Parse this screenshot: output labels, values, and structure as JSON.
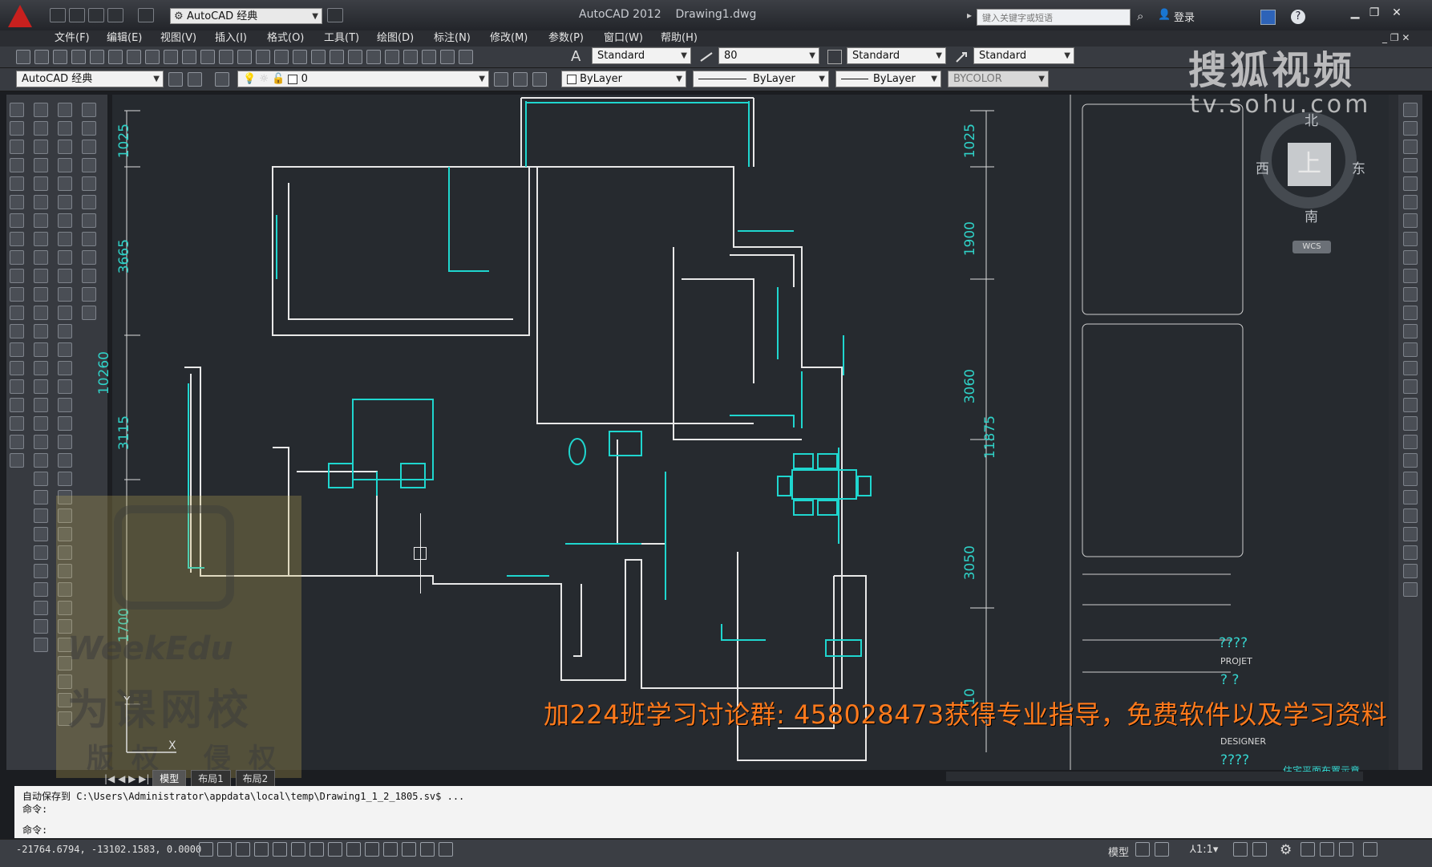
{
  "app": {
    "title": "AutoCAD 2012",
    "file": "Drawing1.dwg",
    "workspace": "AutoCAD 经典",
    "search_placeholder": "键入关键字或短语",
    "login_label": "登录"
  },
  "menu": [
    "文件(F)",
    "编辑(E)",
    "视图(V)",
    "插入(I)",
    "格式(O)",
    "工具(T)",
    "绘图(D)",
    "标注(N)",
    "修改(M)",
    "参数(P)",
    "窗口(W)",
    "帮助(H)"
  ],
  "styles_toolbar": {
    "text_style": "Standard",
    "dim_scale": "80",
    "dim_style": "Standard",
    "table_style": "Standard"
  },
  "layers_toolbar": {
    "workspace": "AutoCAD 经典",
    "current_layer": "0",
    "color": "ByLayer",
    "linetype": "ByLayer",
    "lineweight": "ByLayer",
    "plotstyle": "BYCOLOR"
  },
  "overlay": {
    "sohu_logo": "搜狐视频",
    "sohu_url": "tv.sohu.com",
    "banner": "加224班学习讨论群:  458028473获得专业指导，免费软件以及学习资料",
    "watermark_en": "WeekEdu",
    "watermark_cn": "为课网校",
    "watermark_cn2": "版权 侵权"
  },
  "compass": {
    "north": "北",
    "south": "南",
    "east": "东",
    "west": "西",
    "top": "上",
    "wcs": "WCS"
  },
  "dimensions_left": [
    "1025",
    "3665",
    "10260",
    "3115",
    "1700"
  ],
  "dimensions_right": [
    "1025",
    "1900",
    "3060",
    "11875",
    "3050",
    "10"
  ],
  "title_block": {
    "q1": "????",
    "project": "PROJET",
    "q2": "?  ?",
    "designer": "DESIGNER",
    "q3": "????",
    "caption": "住宅平面布置示意"
  },
  "tabs": [
    "模型",
    "布局1",
    "布局2"
  ],
  "command": {
    "line1": "自动保存到 C:\\Users\\Administrator\\appdata\\local\\temp\\Drawing1_1_2_1805.sv$ ...",
    "line2": "命令:",
    "line3": "命令:"
  },
  "status": {
    "coords": "-21764.6794,  -13102.1583,  0.0000",
    "model": "模型",
    "scale": "1:1"
  }
}
